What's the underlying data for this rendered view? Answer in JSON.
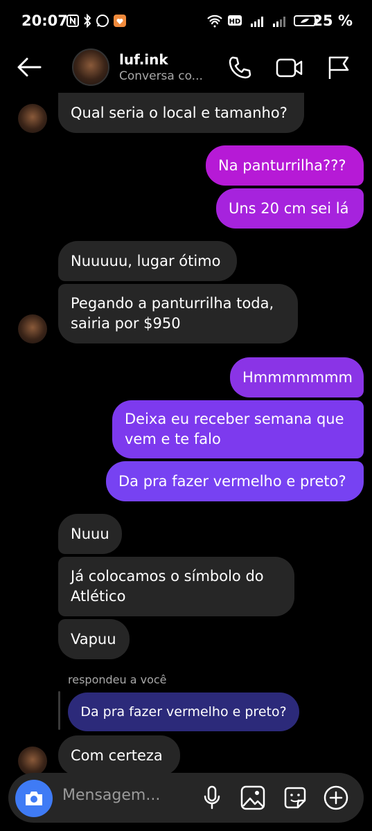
{
  "status_bar": {
    "time": "20:07",
    "battery_percent": "25 %"
  },
  "header": {
    "username": "luf.ink",
    "subtitle": "Conversa co..."
  },
  "messages": [
    {
      "text": "Qual seria o local e tamanho?",
      "side": "in"
    },
    {
      "text": "Na panturrilha???",
      "side": "out"
    },
    {
      "text": "Uns 20 cm sei lá",
      "side": "out"
    },
    {
      "text": "Nuuuuu, lugar ótimo",
      "side": "in"
    },
    {
      "text": "Pegando a panturrilha toda,\nsairia por $950",
      "side": "in"
    },
    {
      "text": "Hmmmmmmm",
      "side": "out"
    },
    {
      "text": "Deixa eu receber semana que\nvem e te falo",
      "side": "out"
    },
    {
      "text": "Da pra fazer vermelho e preto?",
      "side": "out"
    },
    {
      "text": "Nuuu",
      "side": "in"
    },
    {
      "text": "Já colocamos o símbolo do\nAtlético",
      "side": "in"
    },
    {
      "text": "Vapuu",
      "side": "in"
    },
    {
      "text": "Com certeza",
      "side": "in"
    }
  ],
  "reply": {
    "label": "respondeu a você",
    "quoted": "Da pra fazer vermelho e preto?"
  },
  "composer": {
    "placeholder": "Mensagem..."
  },
  "colors": {
    "incoming": "#262626",
    "outgoing_magenta": "#b61ad6",
    "outgoing_purple": "#7a3cf0",
    "camera_button": "#3f7bf5"
  }
}
